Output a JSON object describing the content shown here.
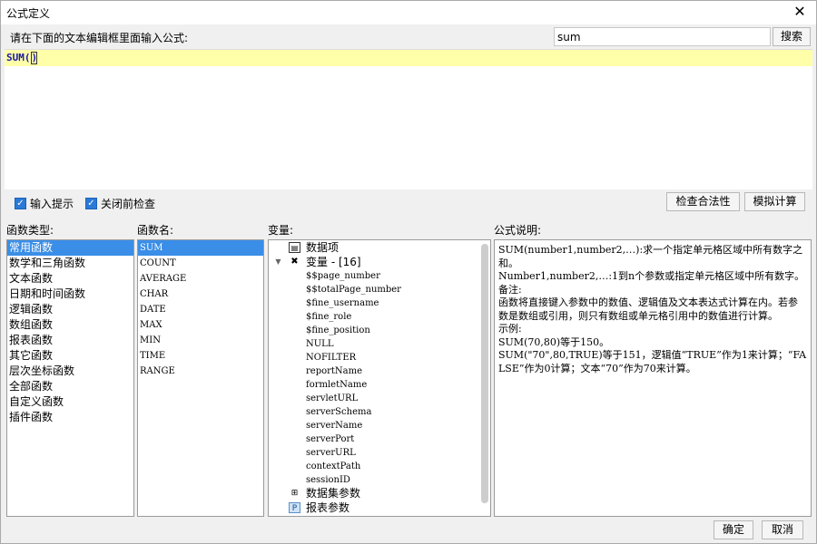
{
  "window": {
    "title": "公式定义"
  },
  "prompt_label": "请在下面的文本编辑框里面输入公式:",
  "search": {
    "value": "sum",
    "button_label": "搜索"
  },
  "editor": {
    "formula": "SUM(",
    "formula_close": ")"
  },
  "options": {
    "input_hint": "输入提示",
    "check_before_close": "关闭前检查"
  },
  "actions": {
    "check_validity": "检查合法性",
    "simulate": "模拟计算"
  },
  "panels": {
    "function_type": "函数类型:",
    "function_name": "函数名:",
    "variables": "变量:",
    "description": "公式说明:"
  },
  "function_types": [
    "常用函数",
    "数学和三角函数",
    "文本函数",
    "日期和时间函数",
    "逻辑函数",
    "数组函数",
    "报表函数",
    "其它函数",
    "层次坐标函数",
    "全部函数",
    "自定义函数",
    "插件函数"
  ],
  "function_names": [
    "SUM",
    "COUNT",
    "AVERAGE",
    "CHAR",
    "DATE",
    "MAX",
    "MIN",
    "TIME",
    "RANGE"
  ],
  "variables_tree": {
    "data_items": "数据项",
    "variable_group": "变量 - [16]",
    "variables": [
      "$$page_number",
      "$$totalPage_number",
      "$fine_username",
      "$fine_role",
      "$fine_position",
      "NULL",
      "NOFILTER",
      "reportName",
      "formletName",
      "servletURL",
      "serverSchema",
      "serverName",
      "serverPort",
      "serverURL",
      "contextPath",
      "sessionID"
    ],
    "dataset_params": "数据集参数",
    "report_params": "报表参数"
  },
  "description": [
    "SUM(number1,number2,…):求一个指定单元格区域中所有数字之和。",
    "Number1,number2,…:1到n个参数或指定单元格区域中所有数字。",
    "备注:",
    "函数将直接键入参数中的数值、逻辑值及文本表达式计算在内。若参数是数组或引用，则只有数组或单元格引用中的数值进行计算。",
    "示例:",
    "SUM(70,80)等于150。",
    "SUM(\"70\",80,TRUE)等于151，逻辑值“TRUE”作为1来计算；“FALSE”作为0计算；文本“70”作为70来计算。"
  ],
  "footer": {
    "ok": "确定",
    "cancel": "取消"
  }
}
